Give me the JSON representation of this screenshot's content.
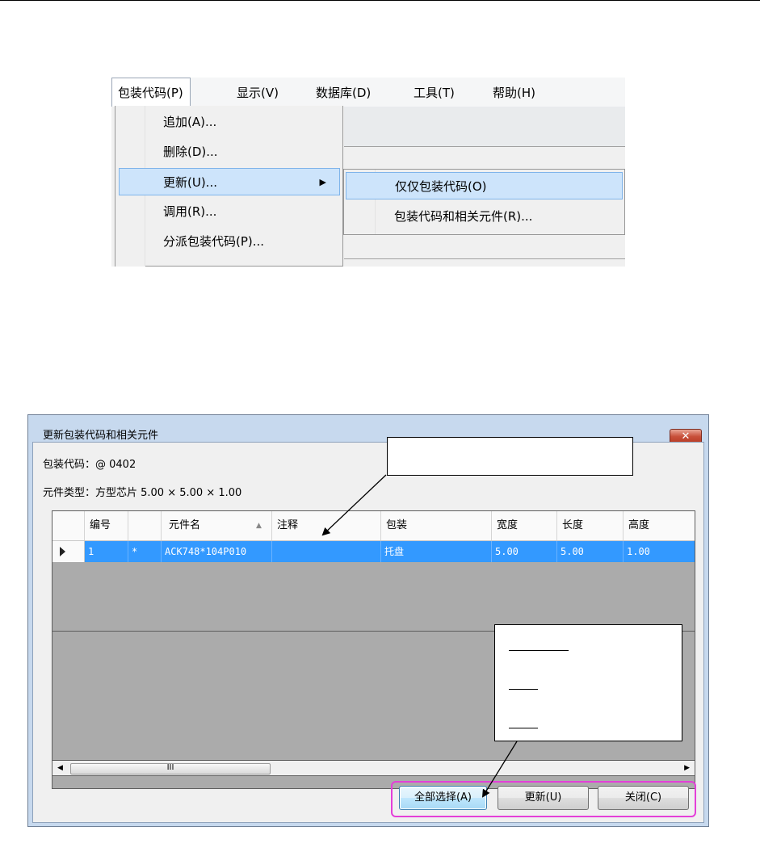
{
  "menu": {
    "bar_items": [
      "包装代码(P)",
      "显示(V)",
      "数据库(D)",
      "工具(T)",
      "帮助(H)"
    ],
    "dropdown_items": [
      "追加(A)...",
      "删除(D)...",
      "更新(U)...",
      "调用(R)...",
      "分派包装代码(P)..."
    ],
    "submenu_items": [
      "仅仅包装代码(O)",
      "包装代码和相关元件(R)..."
    ],
    "submenu_arrow": "▶"
  },
  "dialog": {
    "title": "更新包装代码和相关元件",
    "close_glyph": "✕",
    "package_code_line": "包装代码：@ 0402",
    "component_type_line": "元件类型：方型芯片  5.00 × 5.00 × 1.00",
    "grid": {
      "columns": [
        "编号",
        "",
        "元件名",
        "注释",
        "包装",
        "宽度",
        "长度",
        "高度"
      ],
      "sort_indicator": "▲",
      "rows": [
        [
          "1",
          "*",
          "ACK748*104P010",
          "",
          "托盘",
          "5.00",
          "5.00",
          "1.00"
        ]
      ]
    },
    "scrollbar": {
      "left_arrow": "◀",
      "right_arrow": "▶",
      "thumb_grip": "III"
    },
    "buttons": {
      "select_all": "全部选择(A)",
      "update": "更新(U)",
      "close": "关闭(C)"
    }
  }
}
